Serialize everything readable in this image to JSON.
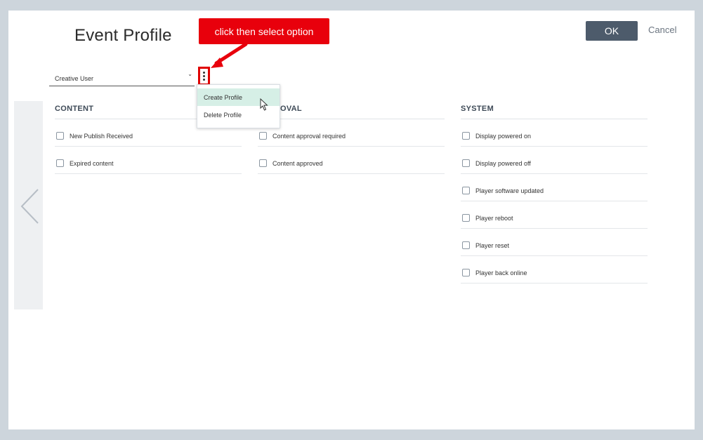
{
  "dialog": {
    "title": "Event Profile",
    "ok_label": "OK",
    "cancel_label": "Cancel"
  },
  "profile": {
    "selected": "Creative User"
  },
  "callout": {
    "text": "click then select option"
  },
  "menu": {
    "items": [
      "Create Profile",
      "Delete Profile"
    ],
    "highlighted": "Create Profile"
  },
  "columns": {
    "content": {
      "title": "CONTENT",
      "items": [
        "New Publish Received",
        "Expired content"
      ]
    },
    "approval": {
      "title": "OVAL",
      "items": [
        "Content approval required",
        "Content approved"
      ]
    },
    "system": {
      "title": "SYSTEM",
      "items": [
        "Display powered on",
        "Display powered off",
        "Player software updated",
        "Player reboot",
        "Player reset",
        "Player back online"
      ]
    }
  },
  "colors": {
    "ok_button": "#4d5b6b",
    "callout": "#e8000c",
    "menu_highlight": "#d6efe6"
  }
}
